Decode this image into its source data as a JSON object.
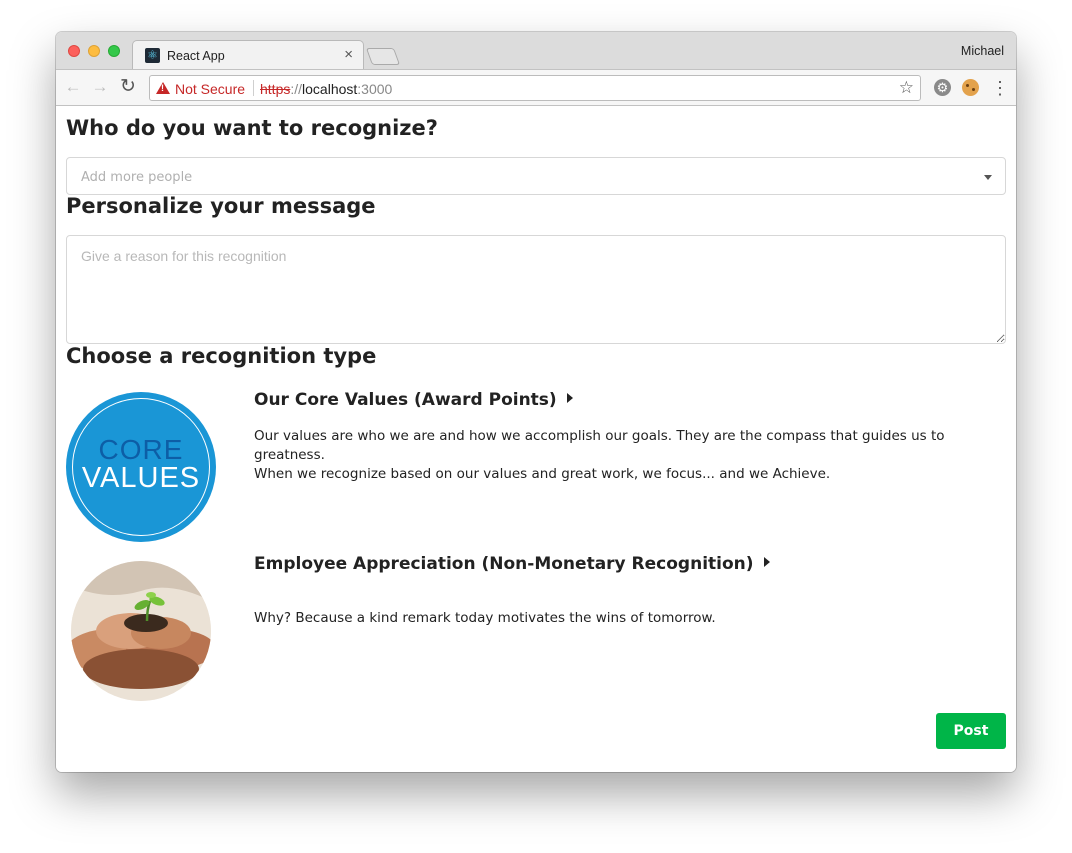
{
  "browser": {
    "tab_title": "React App",
    "tab_close": "×",
    "profile_name": "Michael",
    "security_label": "Not Secure",
    "url_scheme": "https",
    "url_separator": "://",
    "url_host": "localhost",
    "url_port": ":3000",
    "icons": [
      "react-favicon-icon",
      "close-icon",
      "back-icon",
      "forward-icon",
      "reload-icon",
      "warning-icon",
      "star-icon",
      "gear-extension-icon",
      "cookie-extension-icon",
      "menu-icon"
    ]
  },
  "page": {
    "recognize_heading": "Who do you want to recognize?",
    "people_placeholder": "Add more people",
    "personalize_heading": "Personalize your message",
    "message_placeholder": "Give a reason for this recognition",
    "choose_heading": "Choose a recognition type",
    "types": [
      {
        "title": "Our Core Values (Award Points)",
        "description_line1": "Our values are who we are and how we accomplish our goals. They are the compass that guides us to greatness.",
        "description_line2": "When we recognize based on our values and great work, we focus... and we Achieve.",
        "image_text_top": "CORE",
        "image_text_bottom": "VALUES"
      },
      {
        "title": "Employee Appreciation (Non-Monetary Recognition)",
        "description_line1": "Why? Because a kind remark today motivates the wins of tomorrow."
      }
    ],
    "post_label": "Post"
  },
  "colors": {
    "accent_green": "#00b548",
    "core_values_blue": "#1a96d6",
    "not_secure_red": "#c62828"
  }
}
